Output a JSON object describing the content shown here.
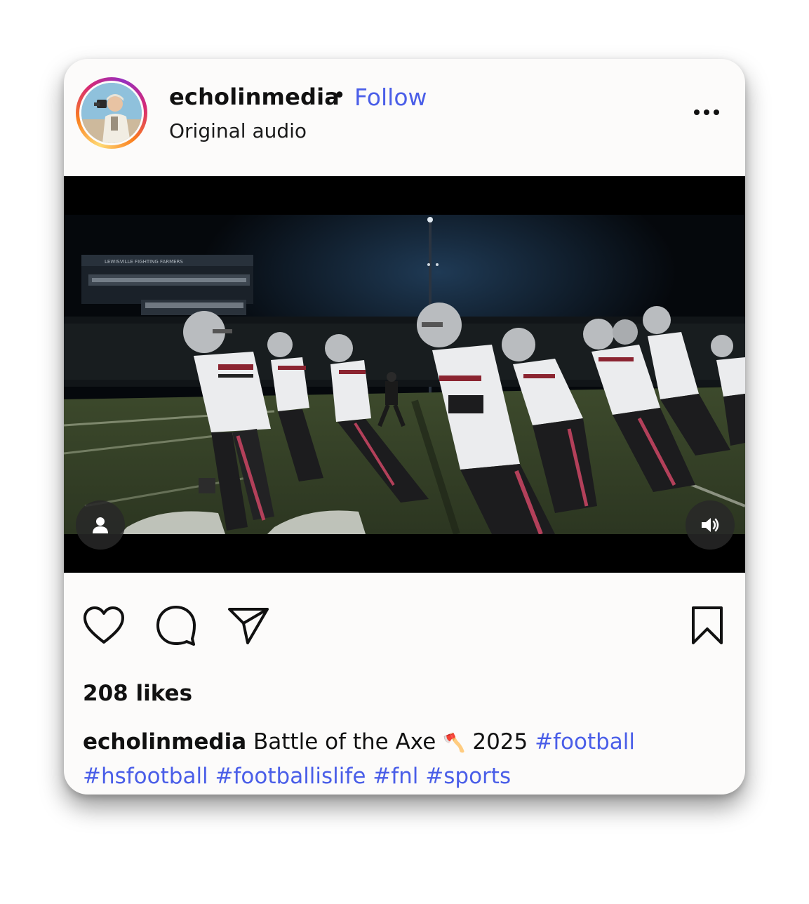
{
  "post": {
    "username": "echolinmedia",
    "separator": "•",
    "follow_label": "Follow",
    "audio_label": "Original audio",
    "more_icon": "more-horizontal-icon"
  },
  "media": {
    "type": "video",
    "user_tag_icon": "person-icon",
    "sound_icon": "speaker-volume-icon",
    "stadium_sign": "LEWISVILLE FIGHTING FARMERS"
  },
  "actions": {
    "like_icon": "heart-icon",
    "comment_icon": "comment-bubble-icon",
    "share_icon": "send-paper-plane-icon",
    "save_icon": "bookmark-icon"
  },
  "likes": "208 likes",
  "caption": {
    "username": "echolinmedia",
    "text": "Battle of the Axe",
    "emoji": "🪓",
    "year": "2025",
    "hashtags": [
      "#football",
      "#hsfootball",
      "#footballislife",
      "#fnl",
      "#sports"
    ]
  },
  "colors": {
    "link": "#4a5ee8",
    "card_bg": "#fcfbfa",
    "text": "#111111"
  }
}
